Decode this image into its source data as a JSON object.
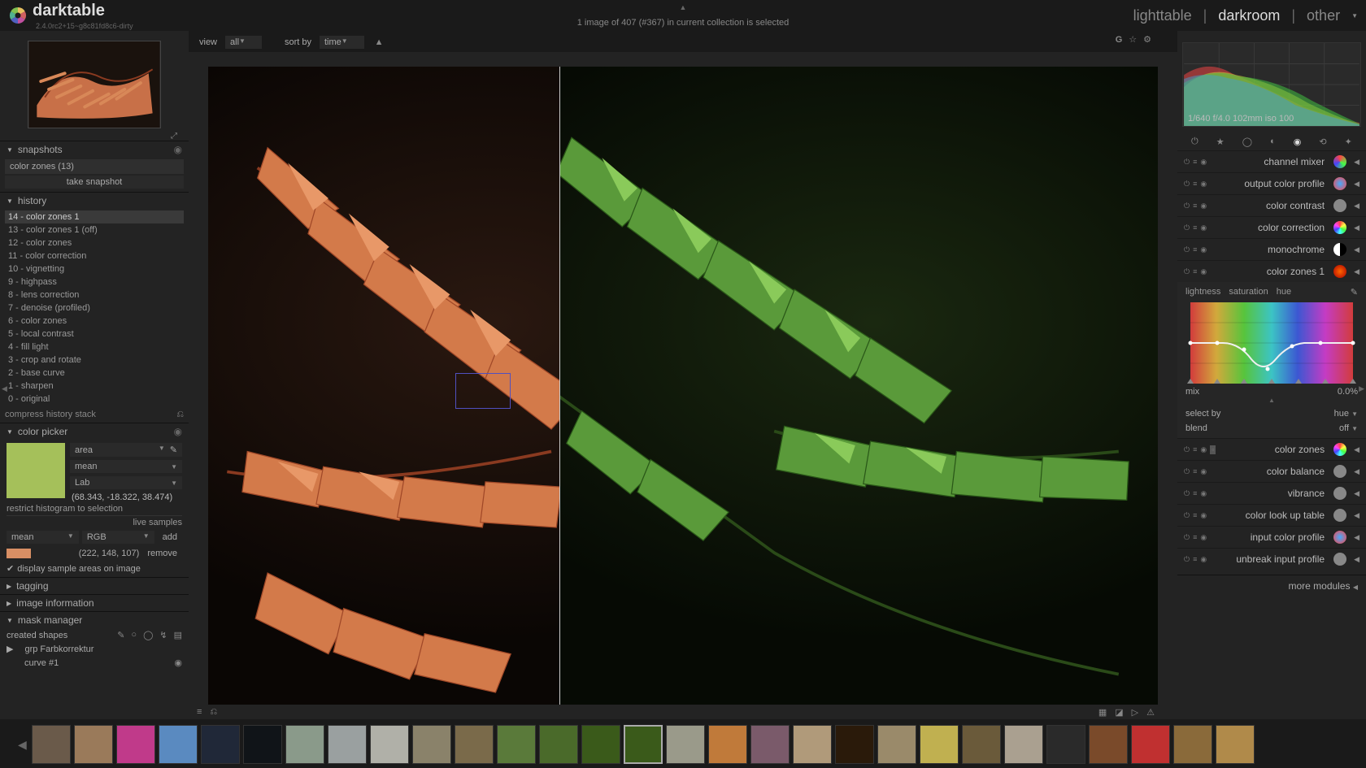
{
  "app": {
    "title": "darktable",
    "version": "2.4.0rc2+15~g8c81fd8c6-dirty"
  },
  "header": {
    "status": "1 image of 407 (#367) in current collection is selected",
    "views": {
      "lighttable": "lighttable",
      "darkroom": "darkroom",
      "other": "other"
    }
  },
  "subheader": {
    "view_label": "view",
    "view_val": "all",
    "sort_label": "sort by",
    "sort_val": "time"
  },
  "left": {
    "snapshots": {
      "title": "snapshots",
      "item": "color zones (13)",
      "button": "take snapshot"
    },
    "history": {
      "title": "history",
      "items": [
        "14 - color zones 1",
        "13 - color zones 1 (off)",
        "12 - color zones",
        "11 - color correction",
        "10 - vignetting",
        "9 - highpass",
        "8 - lens correction",
        "7 - denoise (profiled)",
        "6 - color zones",
        "5 - local contrast",
        "4 - fill light",
        "3 - crop and rotate",
        "2 - base curve",
        "1 - sharpen",
        "0 - original"
      ],
      "compress": "compress history stack"
    },
    "colorpicker": {
      "title": "color picker",
      "mode": "area",
      "stat": "mean",
      "space": "Lab",
      "lab_val": "(68.343, -18.322, 38.474)",
      "restrict": "restrict histogram to selection",
      "live": "live samples",
      "stat2": "mean",
      "space2": "RGB",
      "add": "add",
      "rgb_val": "(222, 148, 107)",
      "remove": "remove",
      "display_chk": "display sample areas on image"
    },
    "tagging": "tagging",
    "imageinfo": "image information",
    "mask": {
      "title": "mask manager",
      "created": "created shapes",
      "grp": "grp Farbkorrektur",
      "curve": "curve #1"
    }
  },
  "right": {
    "histo_meta": "1/640 f/4.0 102mm iso 100",
    "modules": [
      {
        "name": "channel mixer",
        "color": "conic-gradient(#f44,#4f4,#44f,#f44)"
      },
      {
        "name": "output color profile",
        "color": "radial-gradient(#4af,#f44)"
      },
      {
        "name": "color contrast",
        "color": "#888"
      },
      {
        "name": "color correction",
        "color": "conic-gradient(#f44,#ff4,#4f4,#4ff,#44f,#f4f,#f44)"
      },
      {
        "name": "monochrome",
        "color": "linear-gradient(90deg,#fff 50%,#000 50%)"
      },
      {
        "name": "color zones 1",
        "color": "radial-gradient(#f60,#a00)"
      }
    ],
    "cz": {
      "tabs": {
        "l": "lightness",
        "s": "saturation",
        "h": "hue"
      },
      "mix_l": "mix",
      "mix_v": "0.0%",
      "sel_l": "select by",
      "sel_v": "hue",
      "blend_l": "blend",
      "blend_v": "off"
    },
    "modules2": [
      {
        "name": "color zones",
        "color": "conic-gradient(#f44,#ff4,#4f4,#4ff,#44f,#f4f,#f44)"
      },
      {
        "name": "color balance",
        "color": "#888"
      },
      {
        "name": "vibrance",
        "color": "#888"
      },
      {
        "name": "color look up table",
        "color": "#888"
      },
      {
        "name": "input color profile",
        "color": "radial-gradient(#4af,#f44)"
      },
      {
        "name": "unbreak input profile",
        "color": "#888"
      }
    ],
    "more": "more modules"
  },
  "filmstrip_count": 29,
  "filmstrip_sel": 14
}
